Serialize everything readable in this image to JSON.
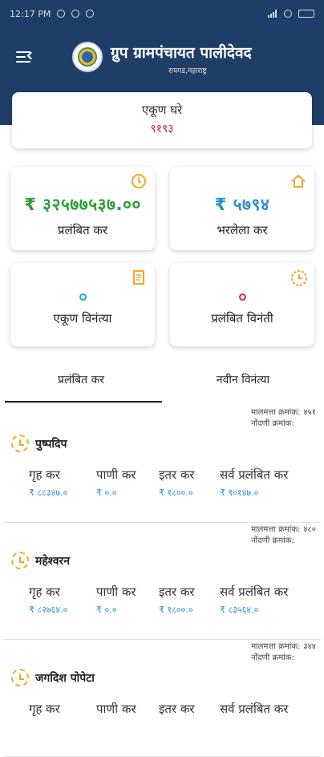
{
  "statusbar": {
    "time": "12:17 PM"
  },
  "header": {
    "title": "ग्रुप ग्रामपंचायत पालीदेवद",
    "subtitle": "रायगड,महाराष्ट्र"
  },
  "total_houses": {
    "label": "एकूण घरे",
    "value": "९१९३"
  },
  "tiles": [
    {
      "value": "₹ ३२५७७५३७.००",
      "label": "प्रलंबित कर",
      "color": "#2e9e3b",
      "icon": "history-icon"
    },
    {
      "value": "₹ ५७९४",
      "label": "भरलेला कर",
      "color": "#2a8fd6",
      "icon": "home-icon"
    },
    {
      "value": "0",
      "label": "एकूण विनंत्या",
      "icon": "receipt-icon"
    },
    {
      "value": "0",
      "label": "प्रलंबित विनंती",
      "icon": "clock-icon"
    }
  ],
  "tabs": [
    "प्रलंबित कर",
    "नवीन विनंत्या"
  ],
  "meta_labels": {
    "property_no": "मालमत्ता क्रमांक:",
    "registration_no": "नोंदणी क्रमांक:"
  },
  "column_headers": [
    "गृह कर",
    "पाणी कर",
    "इतर कर",
    "सर्व प्रलंबित कर"
  ],
  "entries": [
    {
      "property_no": "४५१",
      "registration_no": "",
      "name": "पुष्पदिप",
      "values": [
        "₹ ८८३४७.०",
        "₹ ०.०",
        "₹ १८००.०",
        "₹ ९०१४७.०"
      ]
    },
    {
      "property_no": "४८०",
      "registration_no": "",
      "name": "महेश्वरन",
      "values": [
        "₹ ८२७६४.०",
        "₹ ०.०",
        "₹ १८००.०",
        "₹ ८३५६४.०"
      ]
    },
    {
      "property_no": "३४४",
      "registration_no": "",
      "name": "जगदिश पोपेटा",
      "values": [
        "",
        "",
        "",
        ""
      ]
    }
  ]
}
